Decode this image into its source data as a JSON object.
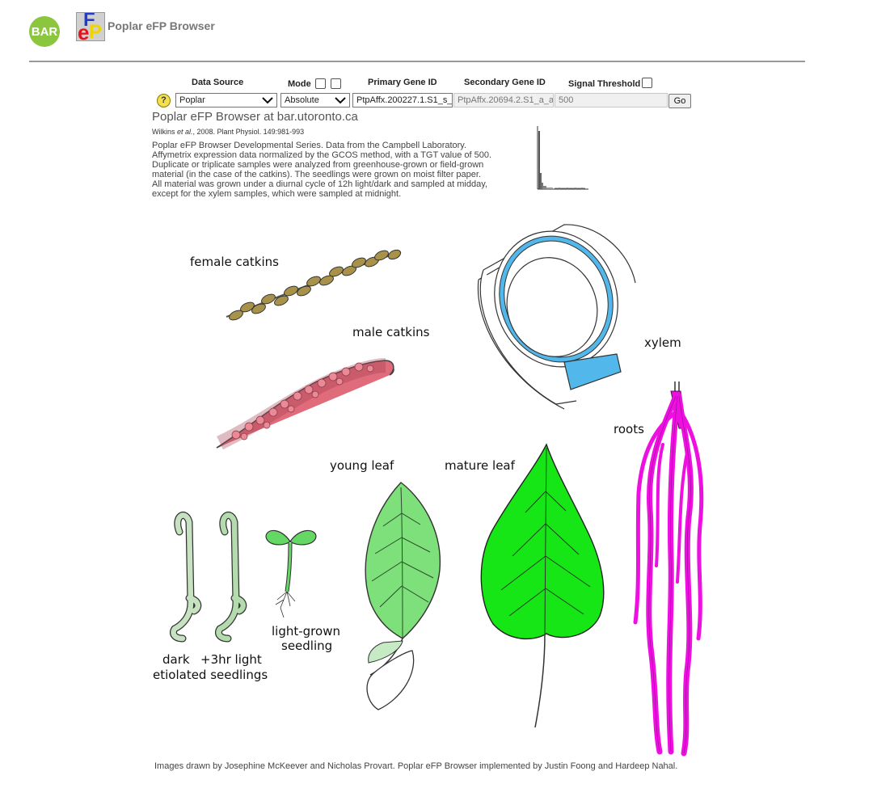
{
  "header": {
    "bar_logo": "BAR",
    "efp_logo": "eFP",
    "title": "Poplar eFP Browser"
  },
  "form": {
    "data_source_label": "Data Source",
    "mode_label": "Mode",
    "primary_gene_label": "Primary Gene ID",
    "secondary_gene_label": "Secondary Gene ID",
    "signal_threshold_label": "Signal Threshold",
    "help_symbol": "?",
    "data_source_value": "Poplar",
    "mode_value": "Absolute",
    "primary_gene_value": "PtpAffx.200227.1.S1_s_",
    "secondary_gene_value": "PtpAffx.20694.2.S1_a_a",
    "threshold_value": "500",
    "go_label": "Go"
  },
  "info": {
    "view_title": "Poplar eFP Browser at bar.utoronto.ca",
    "citation_authors": "Wilkins",
    "citation_etal": "et al.",
    "citation_rest": ", 2008. Plant Physiol. 149:981-993",
    "description_lines": [
      "Poplar eFP Browser Developmental Series. Data from the Campbell Laboratory.",
      "Affymetrix expression data normalized by the GCOS method, with a TGT value of 500.",
      "Duplicate or triplicate samples were analyzed from greenhouse-grown or field-grown",
      "material (in the case of the catkins). The seedlings were grown on moist filter paper.",
      "All material was grown under a diurnal cycle of 12h light/dark and sampled at midday,",
      "except for the xylem samples, which were sampled at midnight."
    ]
  },
  "samples": {
    "female_catkins": "female catkins",
    "male_catkins": "male catkins",
    "xylem": "xylem",
    "roots": "roots",
    "young_leaf": "young leaf",
    "mature_leaf": "mature leaf",
    "light_grown_1": "light-grown",
    "light_grown_2": "seedling",
    "dark": "dark",
    "light3hr": "+3hr light",
    "etiolated": "etiolated seedlings"
  },
  "colors": {
    "female_catkins": "#a8924a",
    "male_catkins": "#e06b7a",
    "xylem": "#52b7ea",
    "roots": "#ee10e0",
    "young_leaf": "#7de07a",
    "mature_leaf": "#16e616",
    "light_seedling": "#65d765",
    "etiolated": "#c7e2c0",
    "light3hr": "#b4dbae"
  },
  "footer": "Images drawn by Josephine McKeever and Nicholas Provart. Poplar eFP Browser implemented by Justin Foong and Hardeep Nahal."
}
